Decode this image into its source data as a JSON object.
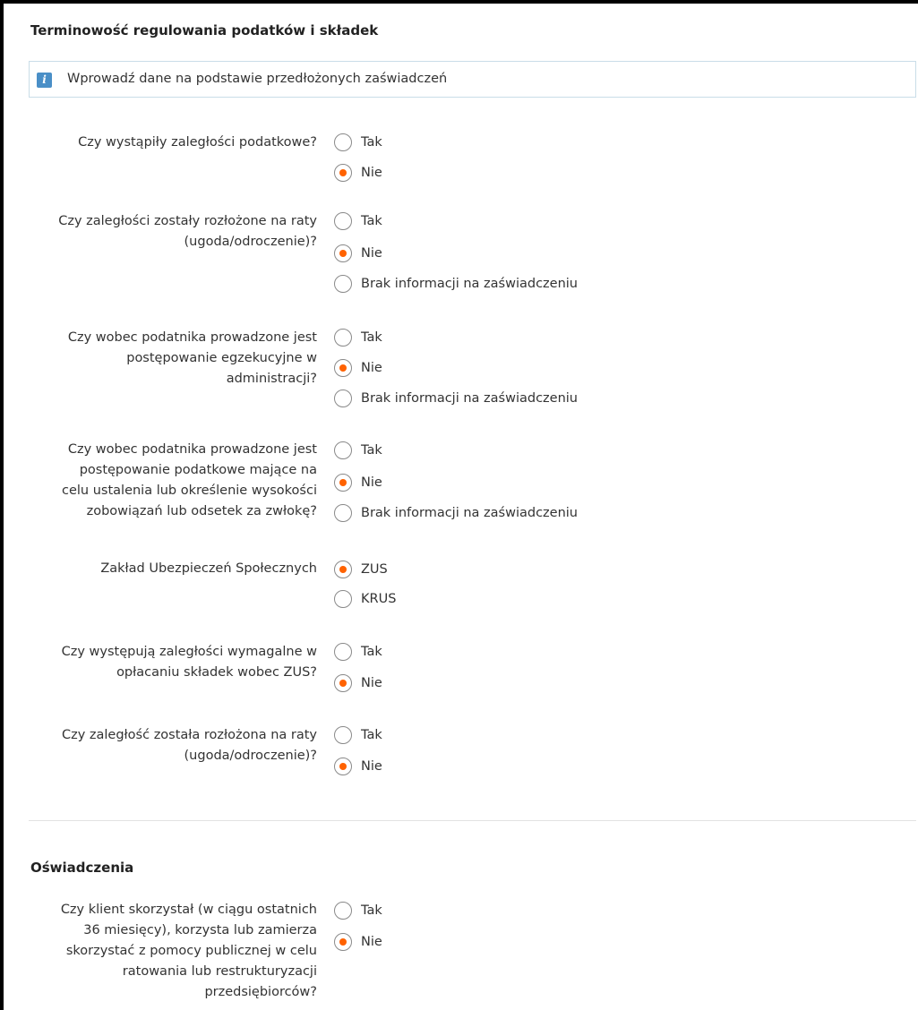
{
  "section1": {
    "title": "Terminowość regulowania podatków i składek",
    "info": "Wprowadź dane na podstawie przedłożonych zaświadczeń"
  },
  "questions": [
    {
      "lines": [
        "Czy wystąpiły zaległości podatkowe?"
      ],
      "options": [
        {
          "label": "Tak",
          "checked": false
        },
        {
          "label": "Nie",
          "checked": true
        }
      ]
    },
    {
      "lines": [
        "Czy zaległości zostały rozłożone na raty",
        "(ugoda/odroczenie)?"
      ],
      "options": [
        {
          "label": "Tak",
          "checked": false
        },
        {
          "label": "Nie",
          "checked": true
        },
        {
          "label": "Brak informacji na zaświadczeniu",
          "checked": false
        }
      ]
    },
    {
      "lines": [
        "Czy wobec podatnika prowadzone jest",
        "postępowanie egzekucyjne w",
        "administracji?"
      ],
      "options": [
        {
          "label": "Tak",
          "checked": false
        },
        {
          "label": "Nie",
          "checked": true
        },
        {
          "label": "Brak informacji na zaświadczeniu",
          "checked": false
        }
      ]
    },
    {
      "lines": [
        "Czy wobec podatnika prowadzone jest",
        "postępowanie podatkowe mające na",
        "celu ustalenia lub określenie wysokości",
        "zobowiązań lub odsetek za zwłokę?"
      ],
      "options": [
        {
          "label": "Tak",
          "checked": false
        },
        {
          "label": "Nie",
          "checked": true
        },
        {
          "label": "Brak informacji na zaświadczeniu",
          "checked": false
        }
      ]
    },
    {
      "lines": [
        "Zakład Ubezpieczeń Społecznych"
      ],
      "options": [
        {
          "label": "ZUS",
          "checked": true
        },
        {
          "label": "KRUS",
          "checked": false
        }
      ]
    },
    {
      "lines": [
        "Czy występują zaległości wymagalne w",
        "opłacaniu składek wobec ZUS?"
      ],
      "options": [
        {
          "label": "Tak",
          "checked": false
        },
        {
          "label": "Nie",
          "checked": true
        }
      ]
    },
    {
      "lines": [
        "Czy zaległość została rozłożona na raty",
        "(ugoda/odroczenie)?"
      ],
      "options": [
        {
          "label": "Tak",
          "checked": false
        },
        {
          "label": "Nie",
          "checked": true
        }
      ]
    }
  ],
  "section2": {
    "title": "Oświadczenia"
  },
  "declaration": {
    "lines": [
      "Czy klient skorzystał (w ciągu ostatnich",
      "36 miesięcy), korzysta lub zamierza",
      "skorzystać z pomocy publicznej w celu",
      "ratowania lub restrukturyzacji",
      "przedsiębiorców?"
    ],
    "options": [
      {
        "label": "Tak",
        "checked": false
      },
      {
        "label": "Nie",
        "checked": true
      }
    ]
  },
  "colors": {
    "accent": "#ff6200",
    "info_icon": "#4a8fc7",
    "info_border": "#c9dde8"
  }
}
